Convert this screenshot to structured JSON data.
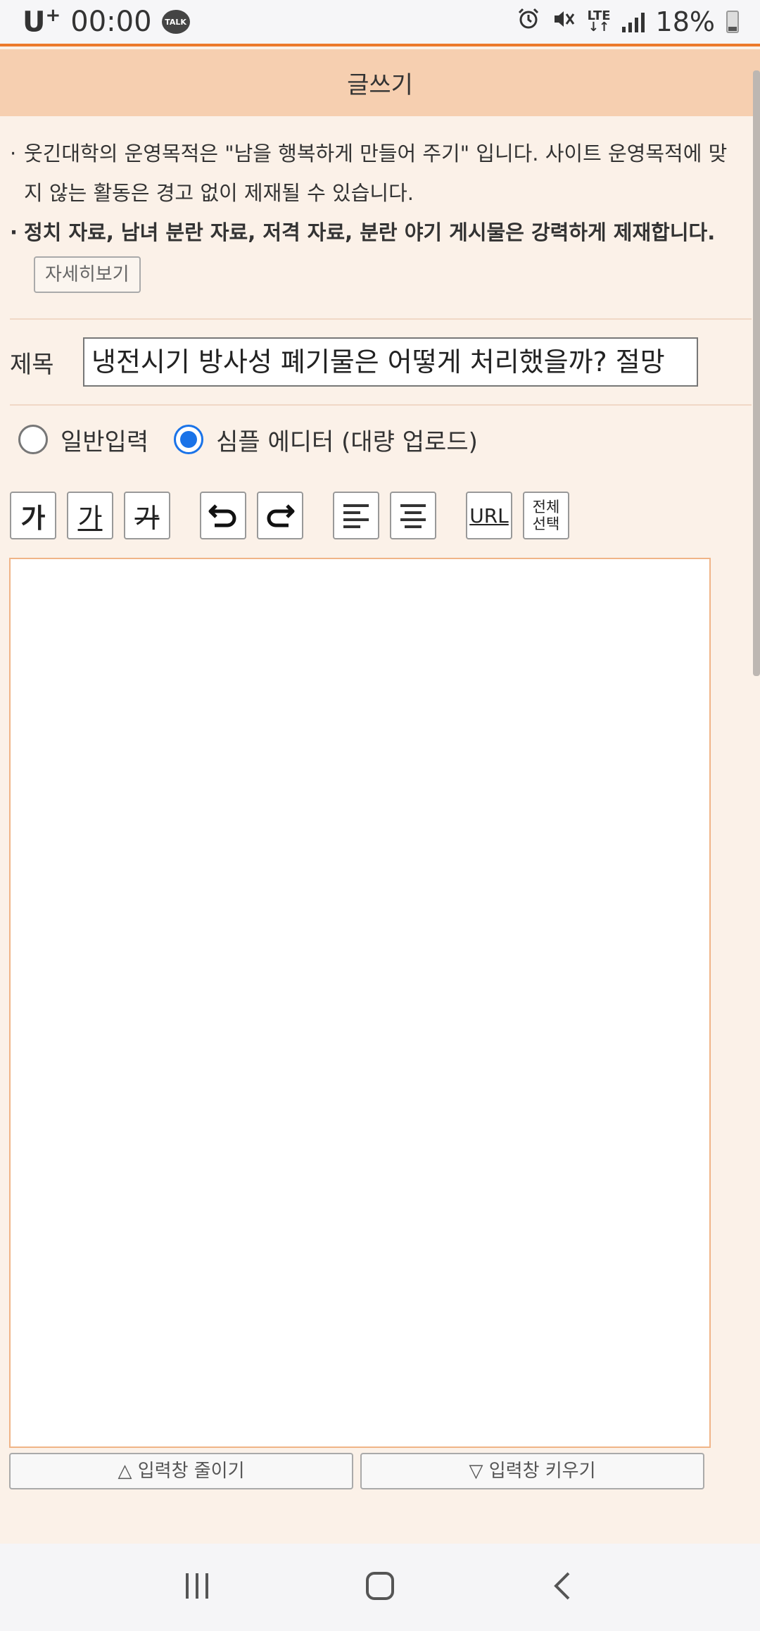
{
  "status_bar": {
    "carrier": "U",
    "carrier_plus": "+",
    "time": "00:00",
    "talk_badge": "TALK",
    "network": "LTE",
    "battery": "18%",
    "icons": [
      "alarm-icon",
      "mute-icon",
      "lte-icon",
      "signal-icon",
      "battery-icon"
    ]
  },
  "header": {
    "title": "글쓰기"
  },
  "notice": {
    "line1": "웃긴대학의 운영목적은 \"남을 행복하게 만들어 주기\" 입니다. 사이트 운영목적에 맞",
    "line1b": "지 않는 활동은 경고 없이 제재될 수 있습니다.",
    "line2": "정치 자료, 남녀 분란 자료, 저격 자료, 분란 야기 게시물은 강력하게 제재합니다.",
    "more_label": "자세히보기"
  },
  "title_field": {
    "label": "제목",
    "value": "냉전시기 방사성 폐기물은 어떻게 처리했을까? 절망"
  },
  "mode": {
    "options": [
      {
        "label": "일반입력",
        "checked": false
      },
      {
        "label": "심플 에디터 (대량 업로드)",
        "checked": true
      }
    ]
  },
  "toolbar": {
    "bold_label": "가",
    "underline_label": "가",
    "strike_label": "가",
    "url_label": "URL",
    "select_all_line1": "전체",
    "select_all_line2": "선택"
  },
  "editor": {
    "content": ""
  },
  "resize": {
    "shrink_label": "△ 입력창 줄이기",
    "grow_label": "▽ 입력창 키우기"
  },
  "colors": {
    "accent": "#ec7a2c",
    "header_bg": "#f6cfb0",
    "page_bg": "#fbf1e8",
    "radio_checked": "#1a73e8"
  }
}
